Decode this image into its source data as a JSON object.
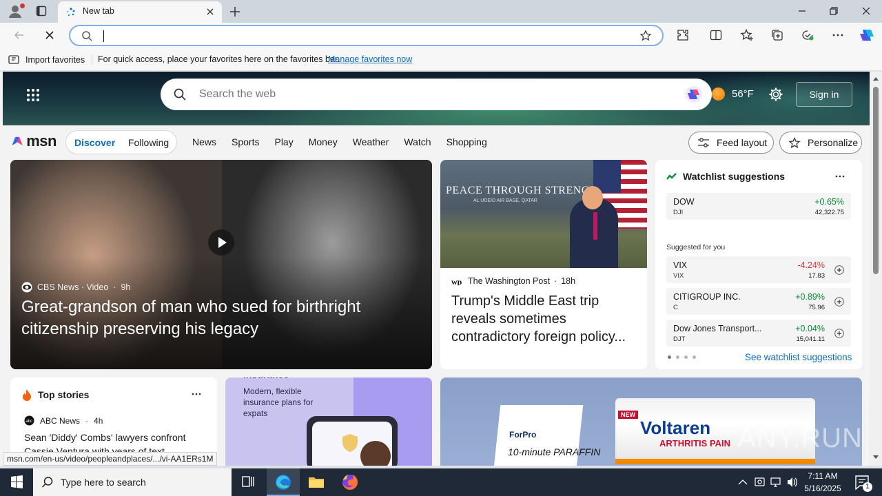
{
  "browser": {
    "tab_title": "New tab",
    "address_value": "",
    "address_placeholder": "",
    "favorites_bar": {
      "import_label": "Import favorites",
      "message": "For quick access, place your favorites here on the favorites bar.",
      "manage_link": "Manage favorites now"
    },
    "status_url": "msn.com/en-us/video/peopleandplaces/.../vi-AA1ERs1M"
  },
  "msn": {
    "search_placeholder": "Search the web",
    "weather_temp": "56°F",
    "signin_label": "Sign in",
    "logo_text": "msn",
    "feed_tabs": [
      "Discover",
      "Following"
    ],
    "nav_links": [
      "News",
      "Sports",
      "Play",
      "Money",
      "Weather",
      "Watch",
      "Shopping"
    ],
    "feed_layout_label": "Feed layout",
    "personalize_label": "Personalize",
    "hero_story": {
      "source": "CBS News · Video",
      "age": "9h",
      "title": "Great-grandson of man who sued for birthright citizenship preserving his legacy"
    },
    "wapo_story": {
      "source": "The Washington Post",
      "age": "18h",
      "image_banner": "PEACE THROUGH STRENGTH",
      "image_banner_sub": "AL UDEID AIR BASE, QATAR",
      "title": "Trump's Middle East trip reveals sometimes contradictory foreign policy..."
    },
    "watchlist": {
      "title": "Watchlist suggestions",
      "main": {
        "name": "DOW",
        "symbol": "DJI",
        "change": "+0.65%",
        "price": "42,322.75"
      },
      "suggested_label": "Suggested for you",
      "suggested": [
        {
          "name": "VIX",
          "symbol": "VIX",
          "change": "-4.24%",
          "price": "17.83"
        },
        {
          "name": "CITIGROUP INC.",
          "symbol": "C",
          "change": "+0.89%",
          "price": "75.96"
        },
        {
          "name": "Dow Jones Transport...",
          "symbol": "DJT",
          "change": "+0.04%",
          "price": "15,041.11"
        }
      ],
      "see_link": "See watchlist suggestions",
      "colors": {
        "up": "#0b8a38",
        "down": "#d13438"
      }
    },
    "top_stories": {
      "title": "Top stories",
      "source": "ABC News",
      "age": "4h",
      "headline": "Sean 'Diddy' Combs' lawyers confront Cassie Ventura with years of text"
    },
    "insurance_ad": {
      "top_text": "insurance",
      "text": "Modern, flexible insurance plans for expats"
    },
    "voltaren_ad": {
      "forpro": "ForPro",
      "forpro_sub": "10-minute PARAFFIN",
      "new_badge": "NEW",
      "brand": "Voltaren",
      "sub": "ARTHRITIS PAIN"
    },
    "watermark": "ANY.RUN"
  },
  "taskbar": {
    "search_placeholder": "Type here to search",
    "time": "7:11 AM",
    "date": "5/16/2025",
    "notification_count": "1"
  }
}
